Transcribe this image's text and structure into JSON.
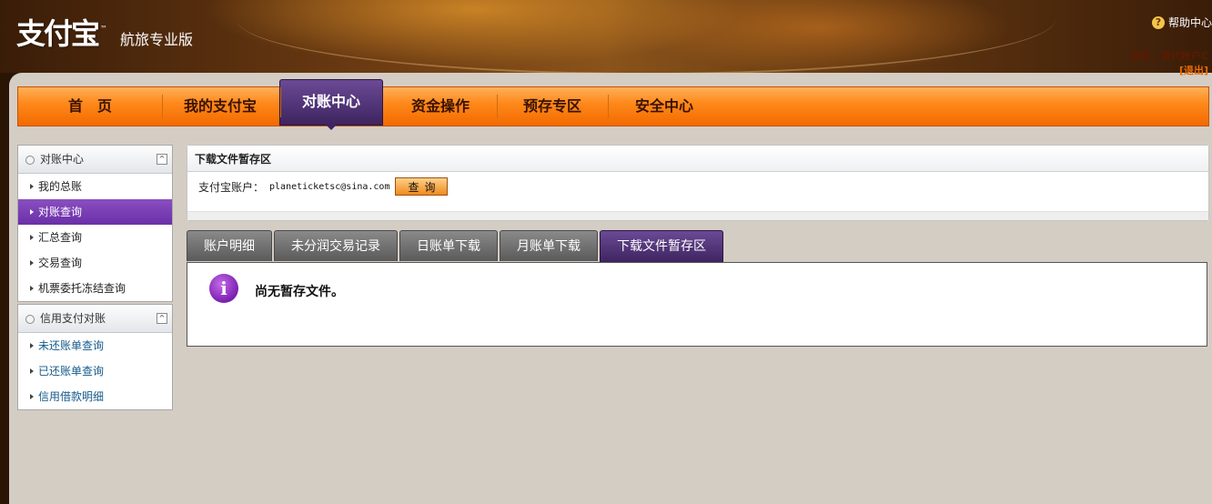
{
  "header": {
    "logo_text": "支付宝",
    "logo_tm": "™",
    "edition": "航旅专业版",
    "help_label": "帮助中心",
    "greeting": "您好，票代帐户C",
    "logout": "[退出]"
  },
  "nav": {
    "items": [
      {
        "label": "首　页",
        "active": false
      },
      {
        "label": "我的支付宝",
        "active": false
      },
      {
        "label": "对账中心",
        "active": true
      },
      {
        "label": "资金操作",
        "active": false
      },
      {
        "label": "预存专区",
        "active": false
      },
      {
        "label": "安全中心",
        "active": false
      }
    ]
  },
  "sidebar": {
    "groups": [
      {
        "title": "对账中心",
        "collapse_glyph": "^",
        "items": [
          "我的总账",
          "对账查询",
          "汇总查询",
          "交易查询",
          "机票委托冻结查询"
        ],
        "active_item": "对账查询"
      },
      {
        "title": "信用支付对账",
        "collapse_glyph": "^",
        "items": [
          "未还账单查询",
          "已还账单查询",
          "信用借款明细"
        ]
      }
    ]
  },
  "panel": {
    "title": "下载文件暂存区",
    "account_label": "支付宝账户：",
    "account_value": "planeticketsc@sina.com",
    "query_button": "查询"
  },
  "tabs": {
    "items": [
      "账户明细",
      "未分润交易记录",
      "日账单下载",
      "月账单下载",
      "下载文件暂存区"
    ],
    "active": "下载文件暂存区"
  },
  "empty_state": {
    "icon": "info-icon",
    "icon_glyph": "i",
    "message": "尚无暂存文件。"
  },
  "colors": {
    "nav_orange": "#ff8a1c",
    "active_purple": "#3e2460",
    "sidebar_active": "#7a3bb4",
    "link_blue": "#145a8a"
  }
}
